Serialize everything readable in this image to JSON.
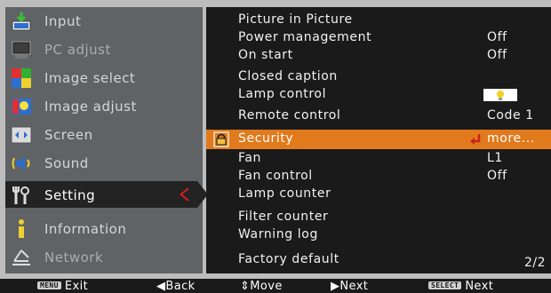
{
  "menu": {
    "items": [
      {
        "label": "Input",
        "icon": "input-icon",
        "state": "normal"
      },
      {
        "label": "PC adjust",
        "icon": "pc-adjust-icon",
        "state": "disabled"
      },
      {
        "label": "Image select",
        "icon": "image-select-icon",
        "state": "normal"
      },
      {
        "label": "Image adjust",
        "icon": "image-adjust-icon",
        "state": "normal"
      },
      {
        "label": "Screen",
        "icon": "screen-icon",
        "state": "normal"
      },
      {
        "label": "Sound",
        "icon": "sound-icon",
        "state": "normal"
      },
      {
        "label": "Setting",
        "icon": "setting-icon",
        "state": "active"
      },
      {
        "label": "Information",
        "icon": "information-icon",
        "state": "normal"
      },
      {
        "label": "Network",
        "icon": "network-icon",
        "state": "disabled"
      }
    ]
  },
  "settings": {
    "rows": [
      {
        "name": "Picture in Picture",
        "value": ""
      },
      {
        "name": "Power management",
        "value": "Off"
      },
      {
        "name": "On start",
        "value": "Off"
      },
      {
        "name": "Closed caption",
        "value": ""
      },
      {
        "name": "Lamp control",
        "value": ""
      },
      {
        "name": "Remote control",
        "value": "Code 1"
      },
      {
        "name": "Security",
        "value": "more..."
      },
      {
        "name": "Fan",
        "value": "L1"
      },
      {
        "name": "Fan control",
        "value": "Off"
      },
      {
        "name": "Lamp counter",
        "value": ""
      },
      {
        "name": "Filter counter",
        "value": ""
      },
      {
        "name": "Warning log",
        "value": ""
      },
      {
        "name": "Factory default",
        "value": ""
      }
    ],
    "page_indicator": "2/2"
  },
  "bottom_bar": {
    "exit_key": "MENU",
    "exit_label": "Exit",
    "back_label": "◀Back",
    "move_label": "⇕Move",
    "next_label": "▶Next",
    "select_key": "SELECT",
    "select_label": "Next"
  },
  "colors": {
    "highlight": "#e07a1c",
    "panel_bg": "#1a1a1a",
    "menu_bg": "#5f6366",
    "arrow": "#e02020"
  }
}
